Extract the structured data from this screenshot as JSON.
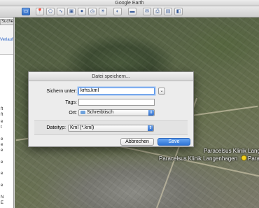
{
  "window": {
    "title": "Google Earth"
  },
  "sidebar": {
    "search_button": "Suche",
    "history_link": "Verlauf",
    "fragments": [
      "ft",
      "ft",
      "e",
      "t",
      "e",
      "e",
      "e",
      "e",
      "e",
      "e",
      "N",
      "E"
    ]
  },
  "dialog": {
    "title": "Datei speichern...",
    "save_as_label": "Sichern unter:",
    "save_as_value": "krhs.kml",
    "tags_label": "Tags:",
    "tags_value": "",
    "location_label": "Ort:",
    "location_value": "Schreibtisch",
    "filetype_label": "Dateityp:",
    "filetype_value": "Kml (*.kml)",
    "cancel_label": "Abbrechen",
    "save_label": "Save",
    "expand_glyph": "⌄"
  },
  "map": {
    "labels": [
      "Paracelsus Klinik Langen",
      "Paracelsus Klinik Langenhagen",
      "Para"
    ]
  },
  "toolbar": {
    "icons": [
      "sidebar-icon",
      "placemark-icon",
      "polygon-icon",
      "path-icon",
      "overlay-icon",
      "tour-icon",
      "history-icon",
      "sun-icon",
      "planets-icon",
      "ruler-icon",
      "email-icon",
      "print-icon",
      "save-image-icon",
      "maps-icon"
    ]
  },
  "colors": {
    "accent": "#3671c8",
    "label_text": "#ffffff"
  }
}
